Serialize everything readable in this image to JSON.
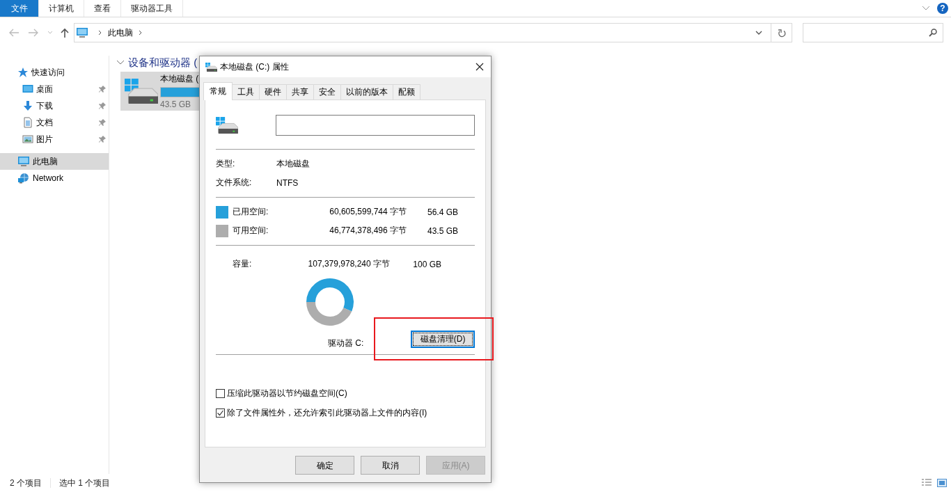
{
  "ribbon": {
    "tabs": [
      {
        "label": "文件",
        "kind": "file"
      },
      {
        "label": "计算机",
        "kind": "tab"
      },
      {
        "label": "查看",
        "kind": "tab"
      },
      {
        "label": "驱动器工具",
        "kind": "tab"
      }
    ],
    "help": "?"
  },
  "address_bar": {
    "path": [
      "此电脑"
    ]
  },
  "sidebar": {
    "items": [
      {
        "label": "快速访问",
        "kind": "star",
        "selected": false,
        "children": [
          {
            "label": "桌面",
            "kind": "desktop",
            "selected": false,
            "pinned": true
          },
          {
            "label": "下载",
            "kind": "download",
            "selected": false,
            "pinned": true
          },
          {
            "label": "文档",
            "kind": "document",
            "selected": false,
            "pinned": true
          },
          {
            "label": "图片",
            "kind": "picture",
            "selected": false,
            "pinned": true
          }
        ]
      },
      {
        "label": "此电脑",
        "kind": "computer",
        "selected": true
      },
      {
        "label": "Network",
        "kind": "network",
        "selected": false
      }
    ]
  },
  "content": {
    "group_heading": "设备和驱动器 (",
    "drives": [
      {
        "name": "本地磁盘 (",
        "level": 0.56,
        "free": "43.5 GB",
        "selected": true
      }
    ]
  },
  "status_bar": [
    "2 个项目",
    "选中 1 个项目"
  ],
  "dialog": {
    "title": "本地磁盘 (C:) 属性",
    "tabs": [
      {
        "label": "常规",
        "selected": true
      },
      {
        "label": "工具",
        "selected": false
      },
      {
        "label": "硬件",
        "selected": false
      },
      {
        "label": "共享",
        "selected": false
      },
      {
        "label": "安全",
        "selected": false
      },
      {
        "label": "以前的版本",
        "selected": false
      },
      {
        "label": "配额",
        "selected": false
      }
    ],
    "properties": [
      {
        "label": "类型:",
        "value": "本地磁盘"
      },
      {
        "label": "文件系统:",
        "value": "NTFS"
      }
    ],
    "space": [
      {
        "label": "已用空间:",
        "bytes": "60,605,599,744 字节",
        "size": "56.4 GB",
        "color": "#26a0da"
      },
      {
        "label": "可用空间:",
        "bytes": "46,774,378,496 字节",
        "size": "43.5 GB",
        "color": "#adadad"
      }
    ],
    "capacity": {
      "label": "容量:",
      "bytes": "107,379,978,240 字节",
      "size": "100 GB"
    },
    "chart_data": {
      "type": "donut",
      "values": [
        56.4,
        43.5
      ]
    },
    "drive_label": "驱动器 C:",
    "cleanup_button": {
      "label": "磁盘清理(D)",
      "focused": true
    },
    "options": [
      {
        "label": "压缩此驱动器以节约磁盘空间(C)",
        "checked": false
      },
      {
        "label": "除了文件属性外，还允许索引此驱动器上文件的内容(I)",
        "checked": true
      }
    ],
    "buttons": [
      {
        "label": "确定",
        "disabled": false
      },
      {
        "label": "取消",
        "disabled": false
      },
      {
        "label": "应用(A)",
        "disabled": true
      }
    ]
  }
}
